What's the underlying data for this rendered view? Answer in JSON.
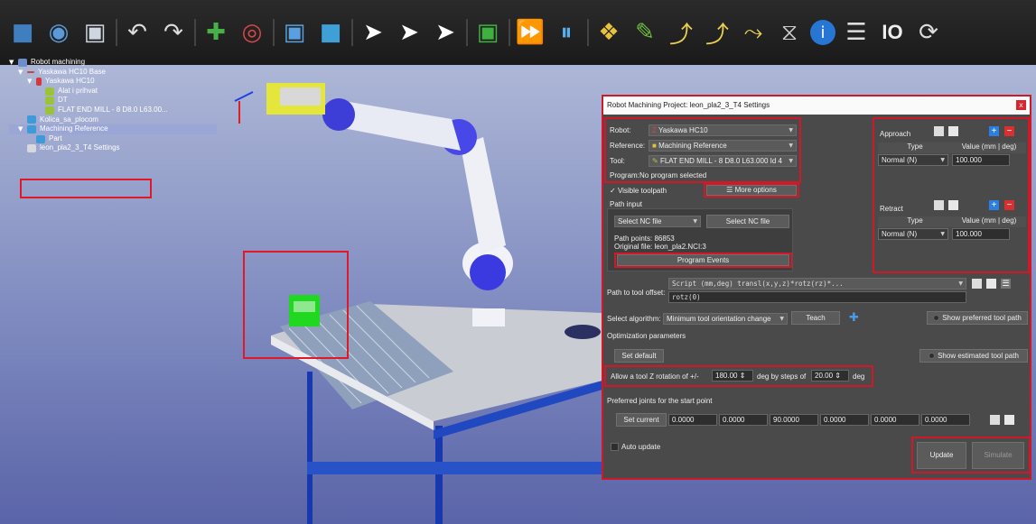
{
  "tree": {
    "items": [
      {
        "label": "Robot machining"
      },
      {
        "label": "Yaskawa HC10 Base"
      },
      {
        "label": "Yaskawa HC10"
      },
      {
        "label": "Alat i prihvat"
      },
      {
        "label": "DT"
      },
      {
        "label": "FLAT END MILL - 8 D8.0 L63.00..."
      },
      {
        "label": "Kolica_sa_plocom"
      },
      {
        "label": "Machining Reference"
      },
      {
        "label": "Part"
      },
      {
        "label": "leon_pla2_3_T4 Settings"
      }
    ]
  },
  "toolbar": {
    "io_label": "IO"
  },
  "dialog": {
    "title": "Robot Machining Project: leon_pla2_3_T4 Settings",
    "close": "x",
    "robot_label": "Robot:",
    "robot_value": "Yaskawa HC10",
    "reference_label": "Reference:",
    "reference_value": "Machining Reference",
    "tool_label": "Tool:",
    "tool_value": "FLAT END MILL - 8 D8.0 L63.000 Id 4",
    "program_label": "Program:",
    "program_value": "No program selected",
    "visible_toolpath": "Visible toolpath",
    "more_options": "More options",
    "path_input": "Path input",
    "select_nc_combo": "Select NC file",
    "select_nc_button": "Select NC file",
    "path_points": "Path points: 86853",
    "original_file": "Original file: leon_pla2.NCI:3",
    "program_events": "Program Events",
    "approach": {
      "title": "Approach",
      "col_type": "Type",
      "col_value": "Value (mm | deg)",
      "type": "Normal (N)",
      "value": "100.000"
    },
    "retract": {
      "title": "Retract",
      "col_type": "Type",
      "col_value": "Value (mm | deg)",
      "type": "Normal (N)",
      "value": "100.000"
    },
    "path_to_tool_label": "Path to tool offset:",
    "path_to_tool_line1": "Script (mm,deg) transl(x,y,z)*rotz(rz)*...",
    "path_to_tool_line2": "rotz(0)",
    "select_algorithm_label": "Select algorithm:",
    "algorithm_value": "Minimum tool orientation change",
    "teach": "Teach",
    "show_preferred": "Show preferred tool path",
    "optimization": "Optimization parameters",
    "set_default": "Set default",
    "show_estimated": "Show estimated tool path",
    "allow_label": "Allow a tool Z rotation of +/-",
    "rotation_value": "180.00",
    "deg_steps": "deg by steps of",
    "step_value": "20.00",
    "deg": "deg",
    "preferred_joints": "Preferred joints for the start point",
    "set_current": "Set current",
    "joints": [
      "0.0000",
      "0.0000",
      "90.0000",
      "0.0000",
      "0.0000",
      "0.0000"
    ],
    "auto_update": "Auto update",
    "update": "Update",
    "simulate": "Simulate"
  }
}
